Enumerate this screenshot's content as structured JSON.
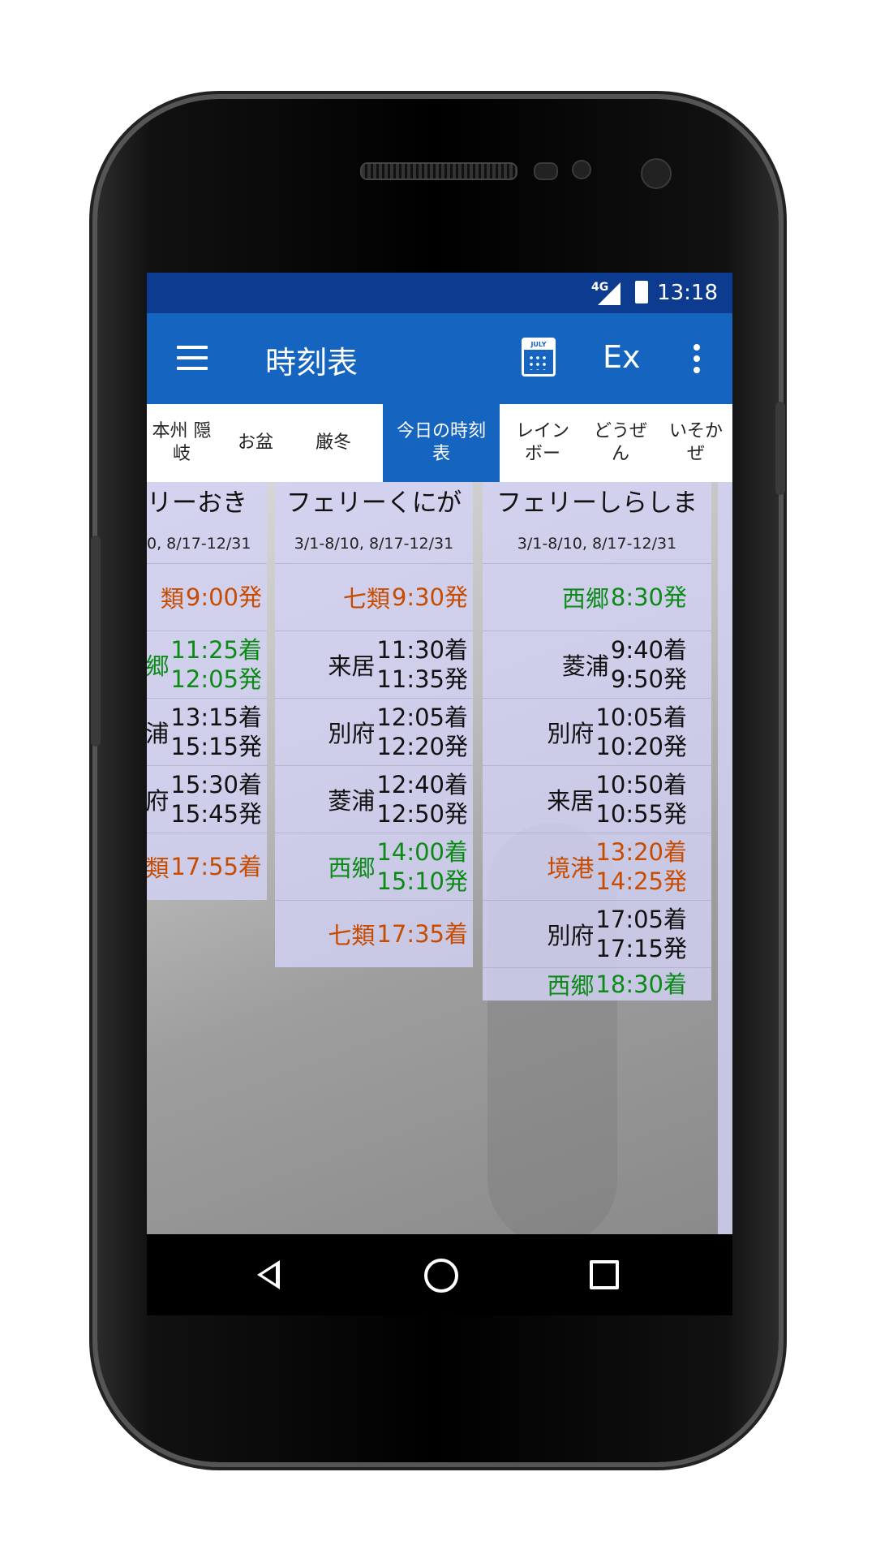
{
  "status_bar": {
    "network": "4G",
    "time": "13:18"
  },
  "app_bar": {
    "title": "時刻表",
    "calendar_icon_label": "JULY",
    "ex_label": "Ex"
  },
  "tabs": [
    {
      "label": "本州 隠岐",
      "active": false
    },
    {
      "label": "お盆",
      "active": false
    },
    {
      "label": "厳冬",
      "active": false
    },
    {
      "label": "今日の時刻表",
      "active": true
    },
    {
      "label": "レインボー",
      "active": false
    },
    {
      "label": "どうぜん",
      "active": false
    },
    {
      "label": "いそかぜ",
      "active": false
    }
  ],
  "columns": [
    {
      "name": "リーおき",
      "dates": "0, 8/17-12/31",
      "rows": [
        {
          "port": "類",
          "times": [
            "9:00発"
          ],
          "color": "orange"
        },
        {
          "port": "郷",
          "times": [
            "11:25着",
            "12:05発"
          ],
          "color": "green"
        },
        {
          "port": "浦",
          "times": [
            "13:15着",
            "15:15発"
          ],
          "color": "black"
        },
        {
          "port": "府",
          "times": [
            "15:30着",
            "15:45発"
          ],
          "color": "black"
        },
        {
          "port": "類",
          "times": [
            "17:55着"
          ],
          "color": "orange"
        }
      ]
    },
    {
      "name": "フェリーくにが",
      "dates": "3/1-8/10, 8/17-12/31",
      "rows": [
        {
          "port": "七類",
          "times": [
            "9:30発"
          ],
          "color": "orange"
        },
        {
          "port": "来居",
          "times": [
            "11:30着",
            "11:35発"
          ],
          "color": "black"
        },
        {
          "port": "別府",
          "times": [
            "12:05着",
            "12:20発"
          ],
          "color": "black"
        },
        {
          "port": "菱浦",
          "times": [
            "12:40着",
            "12:50発"
          ],
          "color": "black"
        },
        {
          "port": "西郷",
          "times": [
            "14:00着",
            "15:10発"
          ],
          "color": "green"
        },
        {
          "port": "七類",
          "times": [
            "17:35着"
          ],
          "color": "orange"
        }
      ]
    },
    {
      "name": "フェリーしらしま",
      "dates": "3/1-8/10, 8/17-12/31",
      "rows": [
        {
          "port": "西郷",
          "times": [
            "8:30発"
          ],
          "color": "green"
        },
        {
          "port": "菱浦",
          "times": [
            "9:40着",
            "9:50発"
          ],
          "color": "black"
        },
        {
          "port": "別府",
          "times": [
            "10:05着",
            "10:20発"
          ],
          "color": "black"
        },
        {
          "port": "来居",
          "times": [
            "10:50着",
            "10:55発"
          ],
          "color": "black"
        },
        {
          "port": "境港",
          "times": [
            "13:20着",
            "14:25発"
          ],
          "color": "orange"
        },
        {
          "port": "別府",
          "times": [
            "17:05着",
            "17:15発"
          ],
          "color": "black"
        },
        {
          "port": "西郷",
          "times": [
            "18:30着"
          ],
          "color": "green"
        }
      ]
    }
  ],
  "colors": {
    "status_bar": "#0d3b8f",
    "app_bar": "#1565c0",
    "green": "#0b8a16",
    "orange": "#c84c00"
  },
  "nav": {
    "back": "back-icon",
    "home": "home-icon",
    "recent": "recent-apps-icon"
  }
}
